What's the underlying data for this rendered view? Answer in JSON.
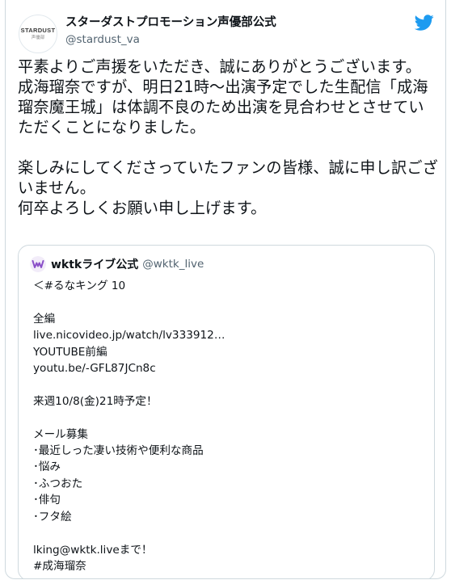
{
  "account": {
    "display_name": "スターダストプロモーション声優部公式",
    "handle": "@stardust_va",
    "avatar_logo": "STARDUST",
    "avatar_sub": "声優部"
  },
  "tweet": {
    "text": "平素よりご声援をいただき、誠にありがとうございます。\n成海瑠奈ですが、明日21時～出演予定でした生配信「成海瑠奈魔王城」は体調不良のため出演を見合わせとさせていただくことになりました。\n\n楽しみにしてくださっていたファンの皆様、誠に申し訳ございません。\n何卒よろしくお願い申し上げます。"
  },
  "quote": {
    "display_name": "wktkライブ公式",
    "handle": "@wktk_live",
    "text": "＜#るなキング 10\n\n全編\nlive.nicovideo.jp/watch/lv333912…\nYOUTUBE前編\nyoutu.be/-GFL87JCn8c\n\n来週10/8(金)21時予定！\n\nメール募集\n･最近しった凄い技術や便利な商品\n･悩み\n･ふつおた\n･俳句\n･フタ絵\n\nlking@wktk.liveまで！\n#成海瑠奈"
  },
  "colors": {
    "twitter_blue": "#1d9bf0",
    "text_primary": "#0f1419",
    "text_secondary": "#536471",
    "border": "#cfd9de",
    "quote_avatar_purple": "#8a4fc8"
  },
  "icons": {
    "brand": "twitter-bird-icon",
    "quote_avatar": "wktk-logo-icon"
  }
}
